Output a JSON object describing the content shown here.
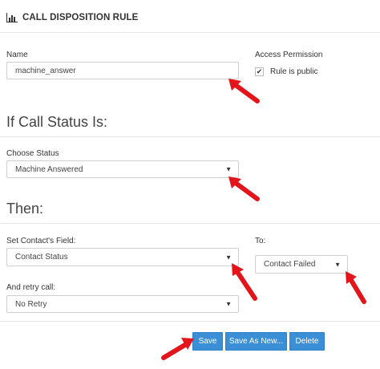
{
  "header": {
    "title": "CALL DISPOSITION RULE",
    "icon": "bar-chart-icon"
  },
  "name_field": {
    "label": "Name",
    "value": "machine_answer"
  },
  "access": {
    "label": "Access Permission",
    "checkbox_label": "Rule is public",
    "checked": true
  },
  "if_section": {
    "heading": "If Call Status Is:"
  },
  "choose_status": {
    "label": "Choose Status",
    "value": "Machine Answered"
  },
  "then_section": {
    "heading": "Then:"
  },
  "set_field": {
    "label": "Set Contact's Field:",
    "value": "Contact Status"
  },
  "to_field": {
    "label": "To:",
    "value": "Contact Failed"
  },
  "retry": {
    "label": "And retry call:",
    "value": "No Retry"
  },
  "buttons": {
    "save": "Save",
    "save_as_new": "Save As New...",
    "delete": "Delete"
  },
  "colors": {
    "accent": "#3a8fd6",
    "arrow": "#e3151b"
  }
}
